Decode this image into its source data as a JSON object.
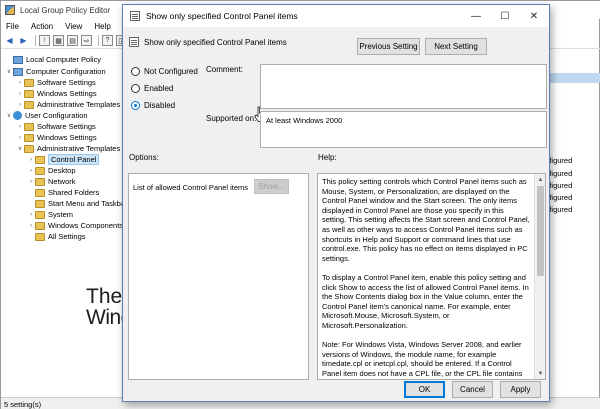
{
  "main": {
    "title": "Local Group Policy Editor",
    "menu": [
      "File",
      "Action",
      "View",
      "Help"
    ],
    "tree": [
      {
        "label": "Local Computer Policy",
        "indent": 0,
        "icon": "computer-icon",
        "exp": ""
      },
      {
        "label": "Computer Configuration",
        "indent": 1,
        "icon": "computer-icon",
        "exp": "∨"
      },
      {
        "label": "Software Settings",
        "indent": 2,
        "icon": "folder-icon",
        "exp": "›"
      },
      {
        "label": "Windows Settings",
        "indent": 2,
        "icon": "folder-icon",
        "exp": "›"
      },
      {
        "label": "Administrative Templates",
        "indent": 2,
        "icon": "folder-icon",
        "exp": "›"
      },
      {
        "label": "User Configuration",
        "indent": 1,
        "icon": "user-icon",
        "exp": "∨"
      },
      {
        "label": "Software Settings",
        "indent": 2,
        "icon": "folder-icon",
        "exp": "›"
      },
      {
        "label": "Windows Settings",
        "indent": 2,
        "icon": "folder-icon",
        "exp": "›"
      },
      {
        "label": "Administrative Templates",
        "indent": 2,
        "icon": "folder-icon",
        "exp": "∨"
      },
      {
        "label": "Control Panel",
        "indent": 3,
        "icon": "folder-icon",
        "exp": "›",
        "selected": true
      },
      {
        "label": "Desktop",
        "indent": 3,
        "icon": "folder-icon",
        "exp": "›"
      },
      {
        "label": "Network",
        "indent": 3,
        "icon": "folder-icon",
        "exp": "›"
      },
      {
        "label": "Shared Folders",
        "indent": 3,
        "icon": "folder-icon",
        "exp": ""
      },
      {
        "label": "Start Menu and Taskba",
        "indent": 3,
        "icon": "folder-icon",
        "exp": ""
      },
      {
        "label": "System",
        "indent": 3,
        "icon": "folder-icon",
        "exp": "›"
      },
      {
        "label": "Windows Components",
        "indent": 3,
        "icon": "folder-icon",
        "exp": "›"
      },
      {
        "label": "All Settings",
        "indent": 3,
        "icon": "folder-icon",
        "exp": ""
      }
    ],
    "right_rows": [
      "onfigured",
      "onfigured",
      "onfigured",
      "onfigured",
      "onfigured"
    ],
    "status": "5 setting(s)"
  },
  "watermark": {
    "line1": "The",
    "line2": "WindowsClub"
  },
  "dialog": {
    "title": "Show only specified Control Panel items",
    "header": "Show only specified Control Panel items",
    "prev_button": "Previous Setting",
    "next_button": "Next Setting",
    "radios": [
      {
        "label": "Not Configured",
        "checked": false
      },
      {
        "label": "Enabled",
        "checked": false
      },
      {
        "label": "Disabled",
        "checked": true
      }
    ],
    "comment_label": "Comment:",
    "supported_label": "Supported on:",
    "supported_value": "At least Windows 2000",
    "options_label": "Options:",
    "help_label": "Help:",
    "options_list_label": "List of allowed Control Panel items",
    "show_button": "Show...",
    "help_paragraphs": [
      "This policy setting controls which Control Panel items such as Mouse, System, or Personalization, are displayed on the Control Panel window and the Start screen. The only items displayed in Control Panel are those you specify in this setting. This setting affects the Start screen and Control Panel, as well as other ways to access Control Panel items such as shortcuts in Help and Support or command lines that use control.exe. This policy has no effect on items displayed in PC settings.",
      "To display a Control Panel item, enable this policy setting and click Show to access the list of allowed Control Panel items. In the Show Contents dialog box in the Value column, enter the Control Panel item's canonical name. For example, enter Microsoft.Mouse, Microsoft.System, or Microsoft.Personalization.",
      "Note: For Windows Vista, Windows Server 2008, and earlier versions of Windows, the module name, for example timedate.cpl or inetcpl.cpl, should be entered. If a Control Panel item does not have a CPL file, or the CPL file contains multiple applets, then its module name and string resource identification"
    ],
    "ok_button": "OK",
    "cancel_button": "Cancel",
    "apply_button": "Apply"
  },
  "colors": {
    "accent": "#0078d7",
    "selection": "#cce4f7"
  }
}
